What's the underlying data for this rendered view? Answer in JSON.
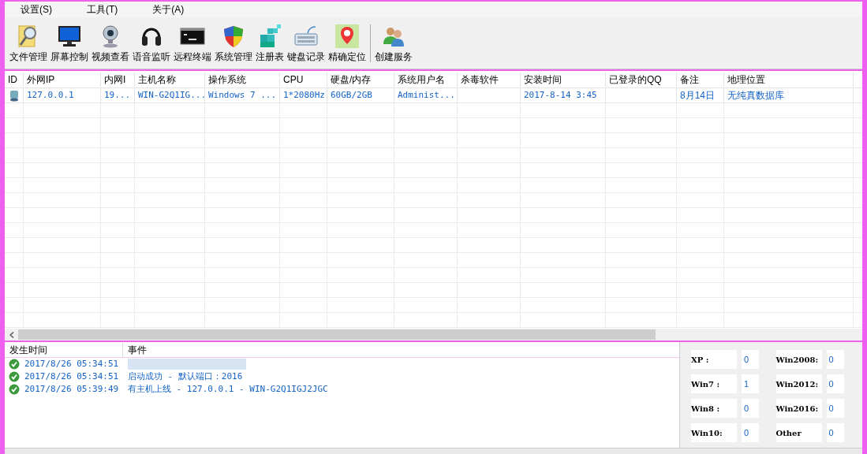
{
  "menu": [
    "设置(S)",
    "工具(T)",
    "关于(A)"
  ],
  "toolbar": [
    {
      "kind": "folder",
      "label": "文件管理"
    },
    {
      "kind": "monitor",
      "label": "屏幕控制"
    },
    {
      "kind": "webcam",
      "label": "视频查看"
    },
    {
      "kind": "headphones",
      "label": "语音监听"
    },
    {
      "kind": "terminal",
      "label": "远程终端"
    },
    {
      "kind": "shield",
      "label": "系统管理"
    },
    {
      "kind": "cubes",
      "label": "注册表"
    },
    {
      "kind": "keyboard",
      "label": "键盘记录"
    },
    {
      "kind": "map",
      "label": "精确定位"
    },
    {
      "kind": "users",
      "label": "创建服务"
    }
  ],
  "table": {
    "columns": [
      "ID",
      "外网IP",
      "内网I",
      "主机名称",
      "操作系统",
      "CPU",
      "硬盘/内存",
      "系统用户名",
      "杀毒软件",
      "安装时间",
      "已登录的QQ",
      "备注",
      "地理位置"
    ],
    "rows": [
      {
        "cells": [
          "",
          "127.0.0.1",
          "19...",
          "WIN-G2Q1IG...",
          "Windows 7 ...",
          "1*2080Hz",
          "60GB/2GB",
          "Administ...",
          "",
          "2017-8-14 3:45",
          "",
          "8月14日",
          "无纯真数据库"
        ]
      }
    ]
  },
  "log": {
    "columns": [
      "发生时间",
      "事件"
    ],
    "rows": [
      {
        "time": "2017/8/26 05:34:51",
        "event": "",
        "redacted": true
      },
      {
        "time": "2017/8/26 05:34:51",
        "event": "启动成功 - 默认端口：2016",
        "redacted": false
      },
      {
        "time": "2017/8/26 05:39:49",
        "event": "有主机上线 - 127.0.0.1 - WIN-G2Q1IGJ2JGC",
        "redacted": false
      }
    ]
  },
  "stats": [
    {
      "label": "XP   :",
      "value": "0"
    },
    {
      "label": "Win2008:",
      "value": "0"
    },
    {
      "label": "Win7 :",
      "value": "1"
    },
    {
      "label": "Win2012:",
      "value": "0"
    },
    {
      "label": "Win8 :",
      "value": "0"
    },
    {
      "label": "Win2016:",
      "value": "0"
    },
    {
      "label": "Win10:",
      "value": "0"
    },
    {
      "label": "Other",
      "value": "0"
    }
  ]
}
